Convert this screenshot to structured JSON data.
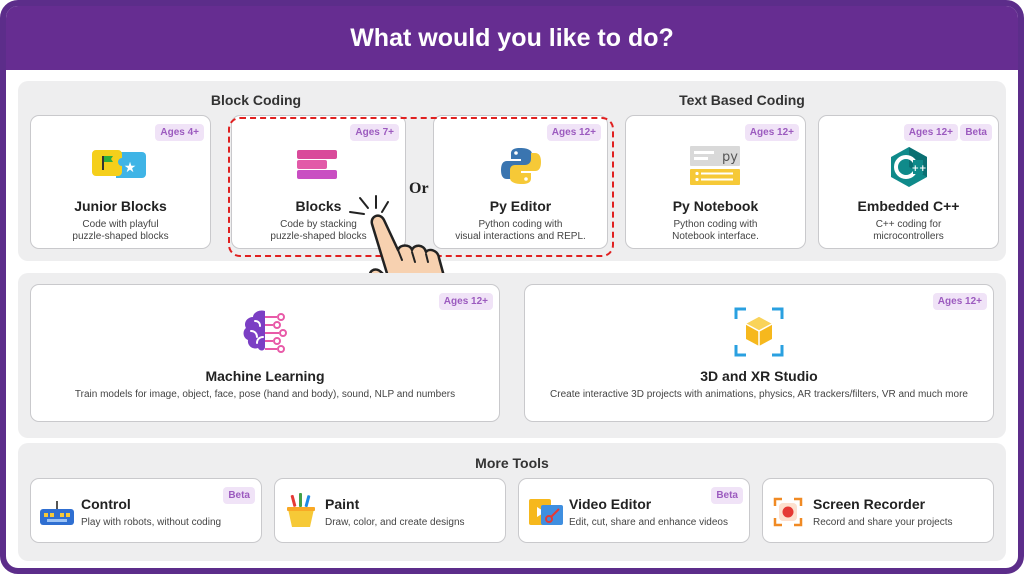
{
  "header": {
    "title": "What would you like to do?"
  },
  "block_coding": {
    "title": "Block Coding",
    "cards": [
      {
        "title": "Junior Blocks",
        "desc": "Code with playful\npuzzle-shaped blocks",
        "badge": "Ages 4+"
      },
      {
        "title": "Blocks",
        "desc": "Code by stacking\npuzzle-shaped blocks",
        "badge": "Ages 7+"
      }
    ]
  },
  "or_label": "Or",
  "text_coding": {
    "title": "Text Based Coding",
    "cards": [
      {
        "title": "Py Editor",
        "desc": "Python coding with\nvisual interactions and REPL.",
        "badge": "Ages 12+"
      },
      {
        "title": "Py Notebook",
        "desc": "Python coding with\nNotebook interface.",
        "badge": "Ages 12+"
      },
      {
        "title": "Embedded C++",
        "desc": "C++ coding for\nmicrocontrollers",
        "badge": "Ages 12+",
        "badge2": "Beta"
      }
    ]
  },
  "studios": [
    {
      "title": "Machine Learning",
      "desc": "Train models for image, object, face, pose (hand and body), sound, NLP and numbers",
      "badge": "Ages 12+"
    },
    {
      "title": "3D and XR Studio",
      "desc": "Create interactive 3D projects with animations, physics, AR trackers/filters, VR and much more",
      "badge": "Ages 12+"
    }
  ],
  "more_tools": {
    "title": "More Tools",
    "tools": [
      {
        "title": "Control",
        "desc": "Play with robots, without coding",
        "badge": "Beta"
      },
      {
        "title": "Paint",
        "desc": "Draw, color, and create designs"
      },
      {
        "title": "Video Editor",
        "desc": "Edit, cut, share and enhance videos",
        "badge": "Beta"
      },
      {
        "title": "Screen Recorder",
        "desc": "Record and share your projects"
      }
    ]
  },
  "icons": {
    "junior_blocks": "puzzle-pieces-icon",
    "blocks": "stacked-blocks-icon",
    "py_editor": "python-logo-icon",
    "py_notebook": "notebook-icon",
    "embedded_cpp": "cpp-hexagon-icon",
    "machine_learning": "brain-circuit-icon",
    "xr_studio": "3d-cube-icon",
    "control": "gamepad-icon",
    "paint": "paint-bucket-icon",
    "video_editor": "video-edit-icon",
    "screen_recorder": "record-icon",
    "pointer": "hand-pointer-icon"
  },
  "colors": {
    "header_purple": "#662d91",
    "badge_bg": "#f0e3f7",
    "badge_text": "#9c5bbf",
    "highlight_dash": "#e02020"
  }
}
